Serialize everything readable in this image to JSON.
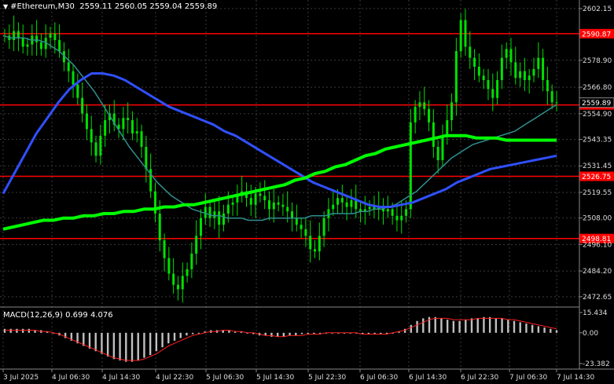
{
  "header": {
    "symbol": "#Ethereum,M30",
    "ohlc": "2559.11 2560.05 2559.04 2559.89"
  },
  "macd_header": {
    "label": "MACD(12,26,9)",
    "values": "0.699 4.076"
  },
  "colors": {
    "background": "#000000",
    "candles": "#00e000",
    "ma_fast": "#2f8f8f",
    "ma_mid": "#3050ff",
    "ma_slow": "#00ff00",
    "levels": "#ff0000",
    "grid": "#3a3a3a",
    "histogram": "#c0c0c0",
    "signal": "#ff2020"
  },
  "price_axis": {
    "ticks": [
      "2602.15",
      "2578.90",
      "2566.80",
      "2554.90",
      "2543.35",
      "2531.45",
      "2519.55",
      "2508.00",
      "2496.10",
      "2484.20",
      "2472.65"
    ],
    "tick_values": [
      2602.15,
      2578.9,
      2566.8,
      2554.9,
      2543.35,
      2531.45,
      2519.55,
      2508.0,
      2496.1,
      2484.2,
      2472.65
    ]
  },
  "macd_axis": {
    "ticks": [
      "15.434",
      "0.00",
      "-23.382"
    ],
    "tick_values": [
      15.434,
      0.0,
      -23.382
    ]
  },
  "time_axis": {
    "labels": [
      "3 Jul 2025",
      "4 Jul 06:30",
      "4 Jul 14:30",
      "4 Jul 22:30",
      "5 Jul 06:30",
      "5 Jul 14:30",
      "5 Jul 22:30",
      "6 Jul 06:30",
      "6 Jul 14:30",
      "6 Jul 22:30",
      "7 Jul 06:30",
      "7 Jul 14:30"
    ]
  },
  "levels": [
    {
      "label": "2590.87",
      "value": 2590.87
    },
    {
      "label": "2558.85",
      "value": 2558.85
    },
    {
      "label": "2526.75",
      "value": 2526.75
    },
    {
      "label": "2498.81",
      "value": 2498.81
    }
  ],
  "current_price": {
    "label": "2559.89",
    "value": 2559.89
  },
  "chart_data": {
    "type": "candlestick",
    "close": [
      2590,
      2588,
      2592,
      2589,
      2585,
      2586,
      2590,
      2587,
      2584,
      2589,
      2591,
      2588,
      2583,
      2578,
      2574,
      2568,
      2562,
      2555,
      2548,
      2542,
      2536,
      2545,
      2552,
      2555,
      2550,
      2548,
      2553,
      2552,
      2546,
      2547,
      2540,
      2530,
      2520,
      2510,
      2498,
      2490,
      2483,
      2478,
      2476,
      2482,
      2485,
      2492,
      2500,
      2508,
      2513,
      2508,
      2511,
      2505,
      2510,
      2514,
      2515,
      2518,
      2520,
      2517,
      2514,
      2519,
      2518,
      2516,
      2512,
      2515,
      2514,
      2513,
      2511,
      2508,
      2505,
      2503,
      2500,
      2494,
      2493,
      2500,
      2508,
      2512,
      2514,
      2517,
      2515,
      2513,
      2516,
      2512,
      2511,
      2512,
      2513,
      2512,
      2513,
      2511,
      2512,
      2509,
      2507,
      2509,
      2512,
      2551,
      2558,
      2560,
      2557,
      2551,
      2540,
      2534,
      2545,
      2552,
      2560,
      2583,
      2597,
      2585,
      2580,
      2576,
      2572,
      2570,
      2566,
      2562,
      2570,
      2580,
      2584,
      2578,
      2571,
      2574,
      2570,
      2572,
      2575,
      2580,
      2570,
      2565,
      2560,
      2560
    ],
    "ma_fast": [
      2590,
      2589,
      2589,
      2589,
      2588,
      2588,
      2587,
      2585,
      2583,
      2580,
      2577,
      2573,
      2569,
      2565,
      2560,
      2555,
      2550,
      2545,
      2540,
      2536,
      2532,
      2528,
      2524,
      2521,
      2518,
      2516,
      2514,
      2512,
      2511,
      2510,
      2509,
      2509,
      2508,
      2508,
      2508,
      2507,
      2507,
      2507,
      2508,
      2508,
      2508,
      2508,
      2508,
      2508,
      2509,
      2509,
      2509,
      2510,
      2510,
      2510,
      2510,
      2511,
      2511,
      2512,
      2512,
      2513,
      2514,
      2516,
      2518,
      2520,
      2523,
      2526,
      2529,
      2532,
      2535,
      2537,
      2539,
      2541,
      2542,
      2543,
      2544,
      2545,
      2546,
      2547,
      2549,
      2551,
      2553,
      2555,
      2557,
      2559
    ],
    "ma_mid": [
      2519,
      2528,
      2537,
      2546,
      2553,
      2560,
      2566,
      2570,
      2573,
      2573,
      2572,
      2570,
      2567,
      2564,
      2561,
      2558,
      2556,
      2554,
      2552,
      2550,
      2547,
      2545,
      2542,
      2539,
      2536,
      2533,
      2530,
      2527,
      2524,
      2522,
      2520,
      2518,
      2516,
      2514,
      2513,
      2513,
      2514,
      2515,
      2517,
      2519,
      2521,
      2524,
      2526,
      2528,
      2530,
      2531,
      2532,
      2533,
      2534,
      2535,
      2536
    ],
    "ma_slow": [
      2503,
      2504,
      2505,
      2506,
      2507,
      2507,
      2508,
      2508,
      2509,
      2509,
      2510,
      2510,
      2511,
      2511,
      2512,
      2512,
      2513,
      2513,
      2514,
      2514,
      2515,
      2516,
      2517,
      2518,
      2519,
      2520,
      2521,
      2522,
      2523,
      2525,
      2526,
      2528,
      2529,
      2531,
      2532,
      2534,
      2536,
      2537,
      2539,
      2540,
      2541,
      2542,
      2543,
      2544,
      2545,
      2545,
      2545,
      2544,
      2544,
      2544,
      2543,
      2543,
      2543,
      2543,
      2543,
      2543
    ],
    "macd_hist": [
      3,
      3,
      3,
      3,
      3,
      2,
      2,
      1,
      0,
      -2,
      -4,
      -6,
      -8,
      -10,
      -12,
      -14,
      -16,
      -18,
      -20,
      -21,
      -22,
      -22,
      -21,
      -19,
      -17,
      -14,
      -11,
      -8,
      -6,
      -4,
      -2,
      -1,
      0,
      1,
      2,
      2,
      2,
      2,
      1,
      1,
      0,
      -1,
      -2,
      -2,
      -3,
      -3,
      -3,
      -2,
      -2,
      -1,
      -1,
      -1,
      0,
      0,
      0,
      0,
      0,
      0,
      0,
      -1,
      -1,
      -1,
      -1,
      -1,
      0,
      1,
      3,
      6,
      9,
      11,
      12,
      12,
      11,
      10,
      9,
      9,
      10,
      11,
      11,
      12,
      12,
      11,
      11,
      10,
      9,
      8,
      7,
      6,
      5,
      4,
      3,
      2
    ],
    "macd_signal": [
      2,
      2,
      2,
      2,
      2,
      2,
      1,
      1,
      0,
      -1,
      -3,
      -5,
      -7,
      -9,
      -11,
      -13,
      -15,
      -17,
      -19,
      -20,
      -21,
      -21,
      -21,
      -20,
      -18,
      -16,
      -13,
      -10,
      -8,
      -6,
      -4,
      -2,
      -1,
      0,
      1,
      1,
      2,
      2,
      1,
      1,
      0,
      0,
      -1,
      -2,
      -2,
      -3,
      -3,
      -2,
      -2,
      -2,
      -1,
      -1,
      -1,
      0,
      0,
      0,
      0,
      0,
      0,
      -1,
      -1,
      -1,
      -1,
      -1,
      0,
      1,
      2,
      4,
      6,
      8,
      10,
      11,
      11,
      11,
      10,
      10,
      10,
      10,
      11,
      11,
      11,
      11,
      11,
      10,
      10,
      9,
      8,
      7,
      6,
      5,
      4,
      3
    ]
  }
}
